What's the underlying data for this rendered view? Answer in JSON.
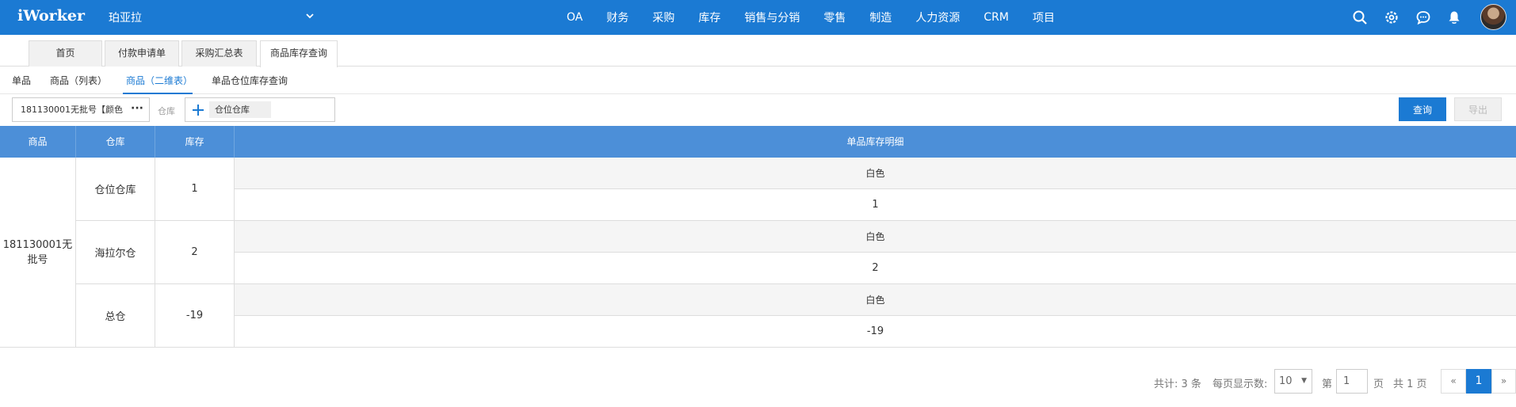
{
  "app": {
    "logo": "iWorker",
    "company": "珀亚拉"
  },
  "menu": [
    "OA",
    "财务",
    "采购",
    "库存",
    "销售与分销",
    "零售",
    "制造",
    "人力资源",
    "CRM",
    "项目"
  ],
  "tabs": [
    "首页",
    "付款申请单",
    "采购汇总表",
    "商品库存查询"
  ],
  "subnav": [
    "单品",
    "商品（列表）",
    "商品（二维表）",
    "单品仓位库存查询"
  ],
  "filter": {
    "product_value": "181130001无批号【颜色",
    "ellipsis": "···",
    "warehouse_label": "仓库",
    "warehouse_chip": "仓位仓库",
    "query_label": "查询",
    "export_label": "导出"
  },
  "table": {
    "headers": [
      "商品",
      "仓库",
      "库存",
      "单品库存明细"
    ],
    "product": "181130001无批号",
    "rows": [
      {
        "warehouse": "仓位仓库",
        "stock": "1",
        "color": "白色",
        "detail": "1"
      },
      {
        "warehouse": "海拉尔仓",
        "stock": "2",
        "color": "白色",
        "detail": "2"
      },
      {
        "warehouse": "总仓",
        "stock": "-19",
        "color": "白色",
        "detail": "-19"
      }
    ]
  },
  "pager": {
    "total": "共计: 3 条",
    "page_size_label": "每页显示数:",
    "page_size": "10",
    "page_prefix": "第",
    "page_value": "1",
    "page_suffix": "页",
    "total_pages": "共 1 页",
    "prev": "«",
    "current": "1",
    "next": "»"
  },
  "colors": {
    "primary": "#1b7ad3",
    "table_header": "#4c8fd8"
  }
}
